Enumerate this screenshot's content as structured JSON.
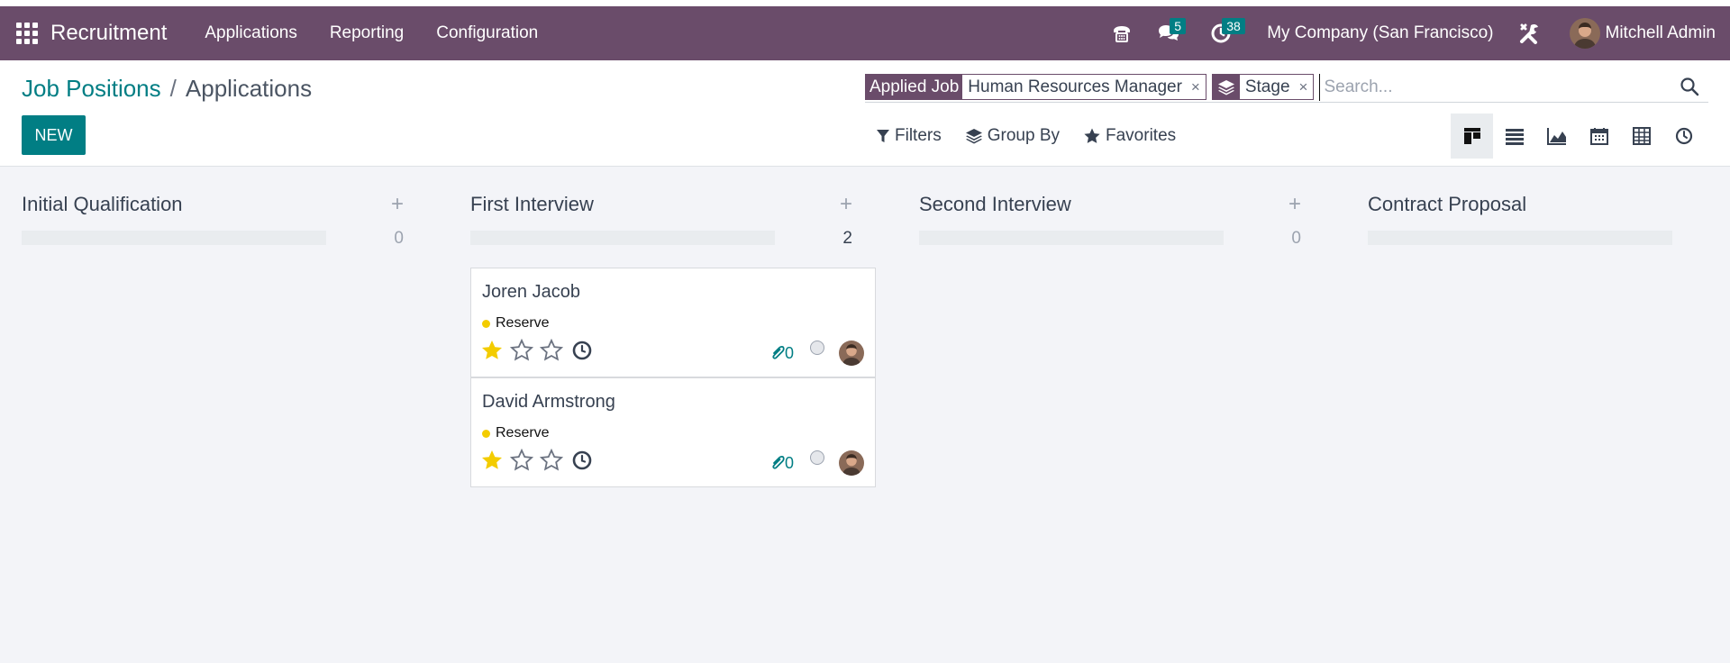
{
  "navbar": {
    "app_name": "Recruitment",
    "menu": [
      "Applications",
      "Reporting",
      "Configuration"
    ],
    "messages_badge": "5",
    "activities_badge": "38",
    "company": "My Company (San Francisco)",
    "user": "Mitchell Admin",
    "color": "#6a4c6a"
  },
  "breadcrumb": {
    "parent": "Job Positions",
    "separator": "/",
    "current": "Applications"
  },
  "new_button": "NEW",
  "search": {
    "facets": [
      {
        "key": "Applied Job",
        "value": "Human Resources Manager",
        "close": "×"
      },
      {
        "icon": "layers-icon",
        "value": "Stage",
        "close": "×"
      }
    ],
    "placeholder": "Search..."
  },
  "filter_bar": {
    "filters": "Filters",
    "group_by": "Group By",
    "favorites": "Favorites"
  },
  "views": [
    "kanban-icon",
    "list-icon",
    "graph-icon",
    "calendar-icon",
    "pivot-icon",
    "activity-icon"
  ],
  "columns": [
    {
      "title": "Initial Qualification",
      "add": "+",
      "count": "0"
    },
    {
      "title": "First Interview",
      "add": "+",
      "count": "2"
    },
    {
      "title": "Second Interview",
      "add": "+",
      "count": "0"
    },
    {
      "title": "Contract Proposal",
      "add": "",
      "count": ""
    }
  ],
  "cards": [
    {
      "name": "Joren Jacob",
      "tag": "Reserve",
      "priority": 1,
      "attachments": "0"
    },
    {
      "name": "David Armstrong",
      "tag": "Reserve",
      "priority": 1,
      "attachments": "0"
    }
  ],
  "accent": "#017e84",
  "star_color": "#f3cc00"
}
